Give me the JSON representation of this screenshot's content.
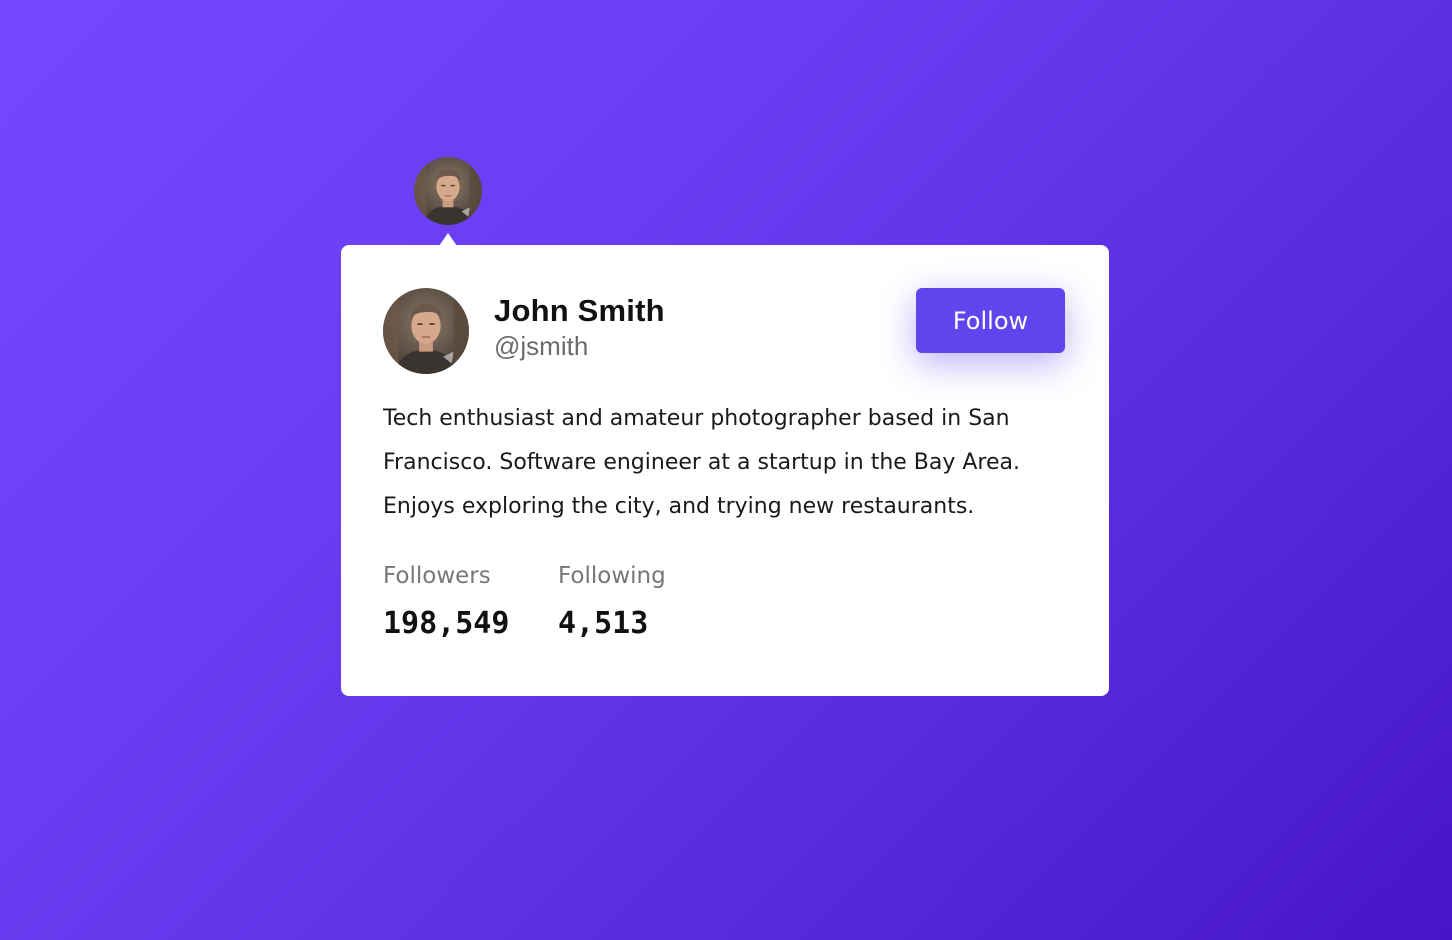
{
  "profile": {
    "name": "John Smith",
    "handle": "@jsmith",
    "bio": "Tech enthusiast and amateur photographer based in San Francisco. Software engineer at a startup in the Bay Area. Enjoys exploring the city, and trying new restaurants.",
    "avatar_icon": "user-portrait"
  },
  "actions": {
    "follow_label": "Follow"
  },
  "stats": {
    "followers": {
      "label": "Followers",
      "value": "198,549"
    },
    "following": {
      "label": "Following",
      "value": "4,513"
    }
  },
  "colors": {
    "background_start": "#7548fd",
    "background_end": "#4715c9",
    "accent": "#6045ee",
    "card": "#ffffff"
  }
}
